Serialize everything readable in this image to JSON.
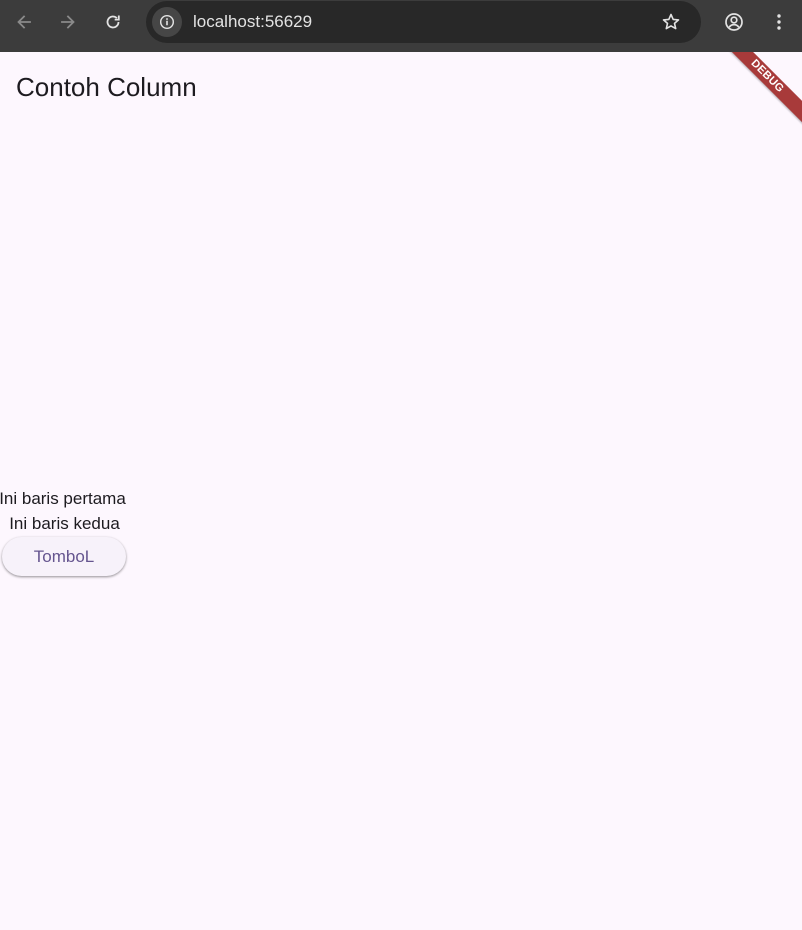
{
  "browser": {
    "url": "localhost:56629",
    "icons": {
      "back": "arrow-left-icon",
      "forward": "arrow-right-icon",
      "reload": "reload-icon",
      "site_info": "info-icon",
      "bookmark": "star-icon",
      "profile": "account-circle-icon",
      "menu": "more-vert-icon"
    },
    "colors": {
      "toolbar": "#3c3c3c",
      "omnibox": "#282828",
      "url_text": "#e3e3e3"
    }
  },
  "app": {
    "title": "Contoh Column",
    "column": {
      "line1": "Ini baris pertama",
      "line2": "Ini baris kedua",
      "button_label": "TomboL"
    },
    "debug_banner": "DEBUG",
    "colors": {
      "background": "#fdf7fe",
      "text": "#1d1b20",
      "button_text": "#65558f",
      "button_bg": "#f7f2fa",
      "debug_banner": "#a83a3a"
    }
  }
}
